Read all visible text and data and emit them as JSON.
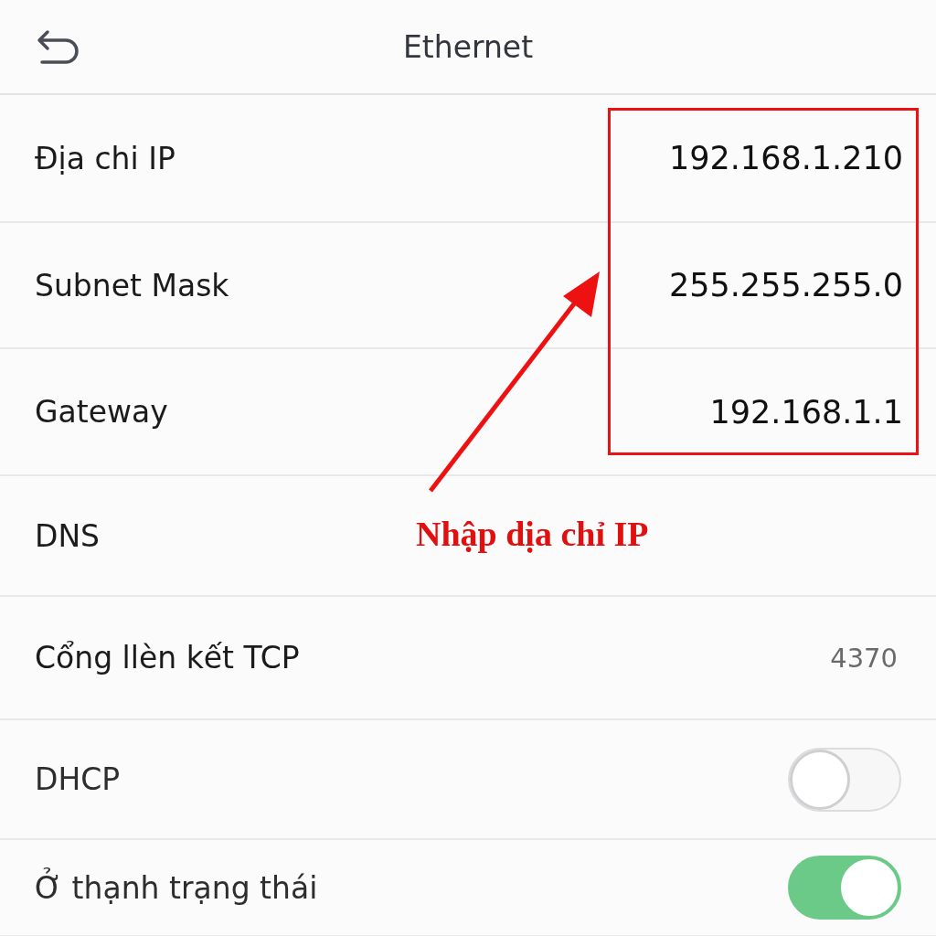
{
  "header": {
    "title": "Ethernet"
  },
  "rows": [
    {
      "kind": "field",
      "label": "Địa chi IP",
      "value": "192.168.1.210"
    },
    {
      "kind": "field",
      "label": "Subnet Mask",
      "value": "255.255.255.0"
    },
    {
      "kind": "field",
      "label": "Gateway",
      "value": "192.168.1.1"
    },
    {
      "kind": "field",
      "label": "DNS"
    },
    {
      "kind": "info",
      "label": "Cổng llèn kết TCP",
      "value": "4370"
    },
    {
      "kind": "toggle",
      "label": "DHCP",
      "on": false
    },
    {
      "kind": "toggle",
      "label": "Ở thạnh trạng thái",
      "on": true
    }
  ],
  "annotation": {
    "label": "Nhập dịa chỉ IP"
  }
}
